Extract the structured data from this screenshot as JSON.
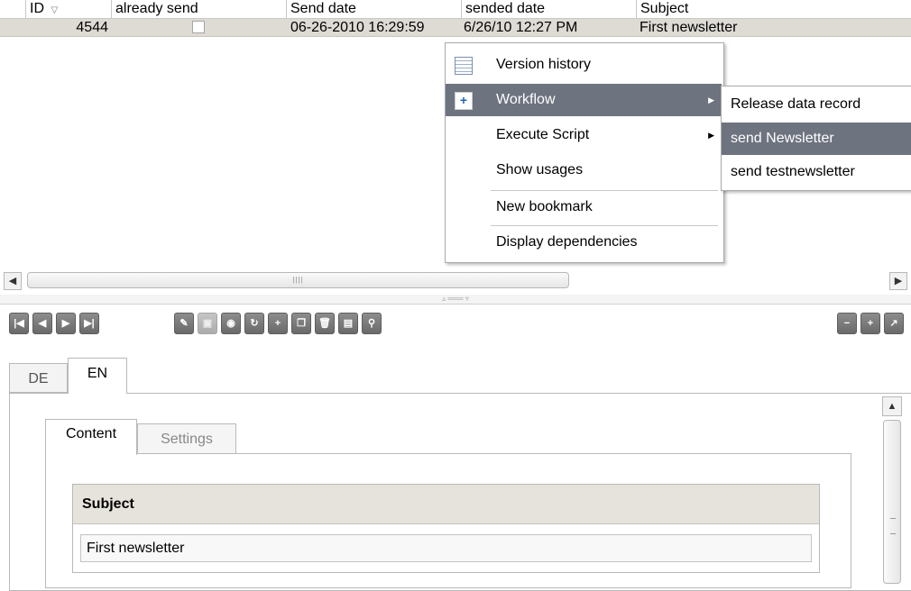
{
  "table": {
    "columns": [
      {
        "label": "ID",
        "sort_icon": "sort-desc-icon"
      },
      {
        "label": "already send"
      },
      {
        "label": "Send date"
      },
      {
        "label": "sended date"
      },
      {
        "label": "Subject"
      }
    ],
    "rows": [
      {
        "id": "4544",
        "already_send": false,
        "send_date": "06-26-2010 16:29:59",
        "sended_date": "6/26/10 12:27 PM",
        "subject": "First newsletter"
      }
    ]
  },
  "context_menu": {
    "items": [
      {
        "label": "Version history",
        "icon": "version-history-icon"
      },
      {
        "label": "Workflow",
        "icon": "workflow-icon",
        "submenu": true
      },
      {
        "label": "Execute Script",
        "submenu": true
      },
      {
        "label": "Show usages"
      },
      {
        "label": "New bookmark"
      },
      {
        "label": "Display dependencies"
      }
    ],
    "selected": "Workflow"
  },
  "submenu": {
    "items": [
      {
        "label": "Release data record"
      },
      {
        "label": "send Newsletter"
      },
      {
        "label": "send testnewsletter"
      }
    ],
    "selected": "send Newsletter"
  },
  "toolbar": {
    "nav_icons": [
      "first-record-icon",
      "previous-record-icon",
      "next-record-icon",
      "last-record-icon"
    ],
    "action_icons": [
      "edit-icon",
      "save-icon",
      "preview-icon",
      "refresh-icon",
      "new-record-icon",
      "copy-icon",
      "delete-icon",
      "columns-icon",
      "search-icon"
    ],
    "right_icons": [
      "collapse-icon",
      "expand-icon",
      "open-external-icon"
    ]
  },
  "language_tabs": [
    "DE",
    "EN"
  ],
  "active_language": "EN",
  "form_tabs": [
    "Content",
    "Settings"
  ],
  "active_form_tab": "Content",
  "form": {
    "subject_label": "Subject",
    "subject_value": "First newsletter"
  },
  "colors": {
    "selected_row": "#dedad4",
    "menu_highlight": "#6e7380"
  }
}
